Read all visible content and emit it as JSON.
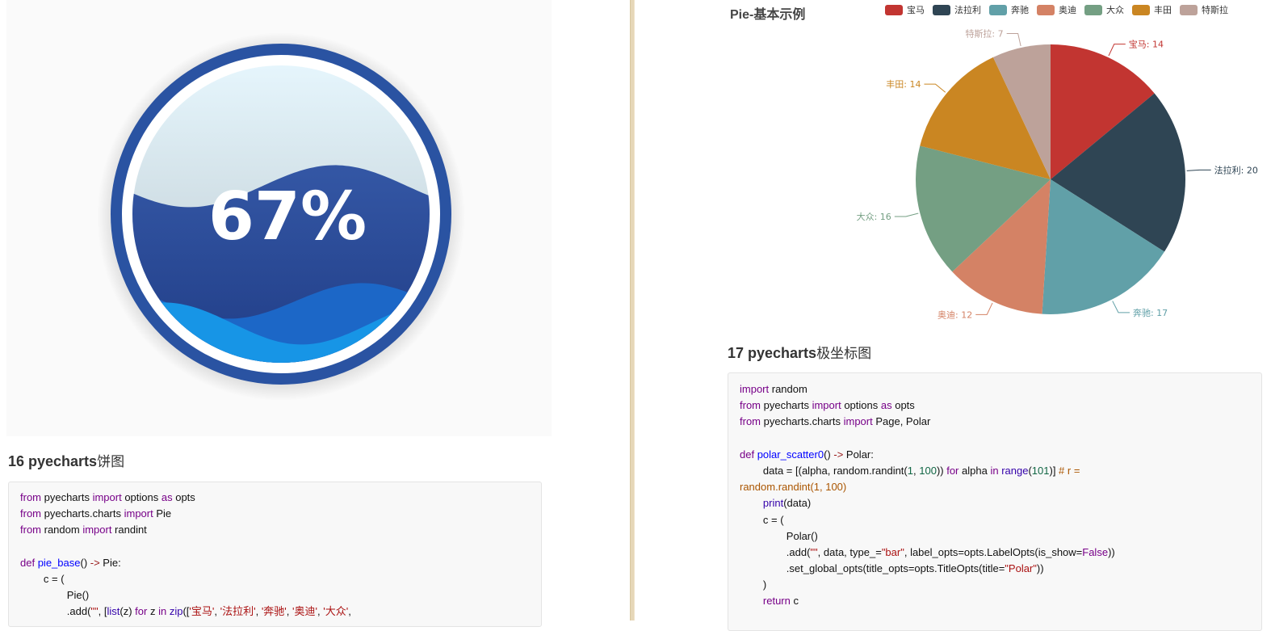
{
  "liquid": {
    "percent_label": "67%",
    "value": 0.67
  },
  "left": {
    "heading_num": "16 pyecharts",
    "heading_cn": "饼图",
    "code": [
      [
        [
          "kw",
          "from"
        ],
        [
          "t",
          " pyecharts "
        ],
        [
          "kw",
          "import"
        ],
        [
          "t",
          " options "
        ],
        [
          "kw",
          "as"
        ],
        [
          "t",
          " opts"
        ]
      ],
      [
        [
          "kw",
          "from"
        ],
        [
          "t",
          " pyecharts.charts "
        ],
        [
          "kw",
          "import"
        ],
        [
          "t",
          " Pie"
        ]
      ],
      [
        [
          "kw",
          "from"
        ],
        [
          "t",
          " random "
        ],
        [
          "kw",
          "import"
        ],
        [
          "t",
          " randint"
        ]
      ],
      [],
      [
        [
          "kw",
          "def"
        ],
        [
          "t",
          " "
        ],
        [
          "fn",
          "pie_base"
        ],
        [
          "t",
          "() "
        ],
        [
          "op",
          "->"
        ],
        [
          "t",
          " Pie:"
        ]
      ],
      [
        [
          "t",
          "        c = ("
        ]
      ],
      [
        [
          "t",
          "                Pie()"
        ]
      ],
      [
        [
          "t",
          "                .add("
        ],
        [
          "str",
          "\"\""
        ],
        [
          "t",
          ", ["
        ],
        [
          "bi",
          "list"
        ],
        [
          "t",
          "(z) "
        ],
        [
          "kw",
          "for"
        ],
        [
          "t",
          " z "
        ],
        [
          "kw",
          "in"
        ],
        [
          "t",
          " "
        ],
        [
          "bi",
          "zip"
        ],
        [
          "t",
          "(["
        ],
        [
          "str",
          "'宝马'"
        ],
        [
          "t",
          ", "
        ],
        [
          "str",
          "'法拉利'"
        ],
        [
          "t",
          ", "
        ],
        [
          "str",
          "'奔驰'"
        ],
        [
          "t",
          ", "
        ],
        [
          "str",
          "'奥迪'"
        ],
        [
          "t",
          ", "
        ],
        [
          "str",
          "'大众'"
        ],
        [
          "t",
          ","
        ]
      ]
    ]
  },
  "right": {
    "heading_num": "17 pyecharts",
    "heading_cn": "极坐标图",
    "code": [
      [
        [
          "kw",
          "import"
        ],
        [
          "t",
          " random"
        ]
      ],
      [
        [
          "kw",
          "from"
        ],
        [
          "t",
          " pyecharts "
        ],
        [
          "kw",
          "import"
        ],
        [
          "t",
          " options "
        ],
        [
          "kw",
          "as"
        ],
        [
          "t",
          " opts"
        ]
      ],
      [
        [
          "kw",
          "from"
        ],
        [
          "t",
          " pyecharts.charts "
        ],
        [
          "kw",
          "import"
        ],
        [
          "t",
          " Page, Polar"
        ]
      ],
      [],
      [
        [
          "kw",
          "def"
        ],
        [
          "t",
          " "
        ],
        [
          "fn",
          "polar_scatter0"
        ],
        [
          "t",
          "() "
        ],
        [
          "op",
          "->"
        ],
        [
          "t",
          " Polar:"
        ]
      ],
      [
        [
          "t",
          "        data = [(alpha, random.randint("
        ],
        [
          "num",
          "1"
        ],
        [
          "t",
          ", "
        ],
        [
          "num",
          "100"
        ],
        [
          "t",
          ")) "
        ],
        [
          "kw",
          "for"
        ],
        [
          "t",
          " alpha "
        ],
        [
          "kw",
          "in"
        ],
        [
          "t",
          " "
        ],
        [
          "bi",
          "range"
        ],
        [
          "t",
          "("
        ],
        [
          "num",
          "101"
        ],
        [
          "t",
          ")] "
        ],
        [
          "cmt",
          "# r ="
        ]
      ],
      [
        [
          "cmt",
          "random.randint(1, 100)"
        ]
      ],
      [
        [
          "t",
          "        "
        ],
        [
          "bi",
          "print"
        ],
        [
          "t",
          "(data)"
        ]
      ],
      [
        [
          "t",
          "        c = ("
        ]
      ],
      [
        [
          "t",
          "                Polar()"
        ]
      ],
      [
        [
          "t",
          "                .add("
        ],
        [
          "str",
          "\"\""
        ],
        [
          "t",
          ", data, type_="
        ],
        [
          "str",
          "\"bar\""
        ],
        [
          "t",
          ", label_opts=opts.LabelOpts(is_show="
        ],
        [
          "kw",
          "False"
        ],
        [
          "t",
          "))"
        ]
      ],
      [
        [
          "t",
          "                .set_global_opts(title_opts=opts.TitleOpts(title="
        ],
        [
          "str",
          "\"Polar\""
        ],
        [
          "t",
          "))"
        ]
      ],
      [
        [
          "t",
          "        )"
        ]
      ],
      [
        [
          "t",
          "        "
        ],
        [
          "kw",
          "return"
        ],
        [
          "t",
          " c"
        ]
      ]
    ]
  },
  "chart_data": {
    "type": "pie",
    "title": "Pie-基本示例",
    "legend_position": "top",
    "categories": [
      "宝马",
      "法拉利",
      "奔驰",
      "奥迪",
      "大众",
      "丰田",
      "特斯拉"
    ],
    "values": [
      14,
      20,
      17,
      12,
      16,
      14,
      7
    ],
    "colors": [
      "#c23531",
      "#2f4554",
      "#61a0a8",
      "#d48265",
      "#749f83",
      "#ca8622",
      "#bda29a"
    ]
  }
}
